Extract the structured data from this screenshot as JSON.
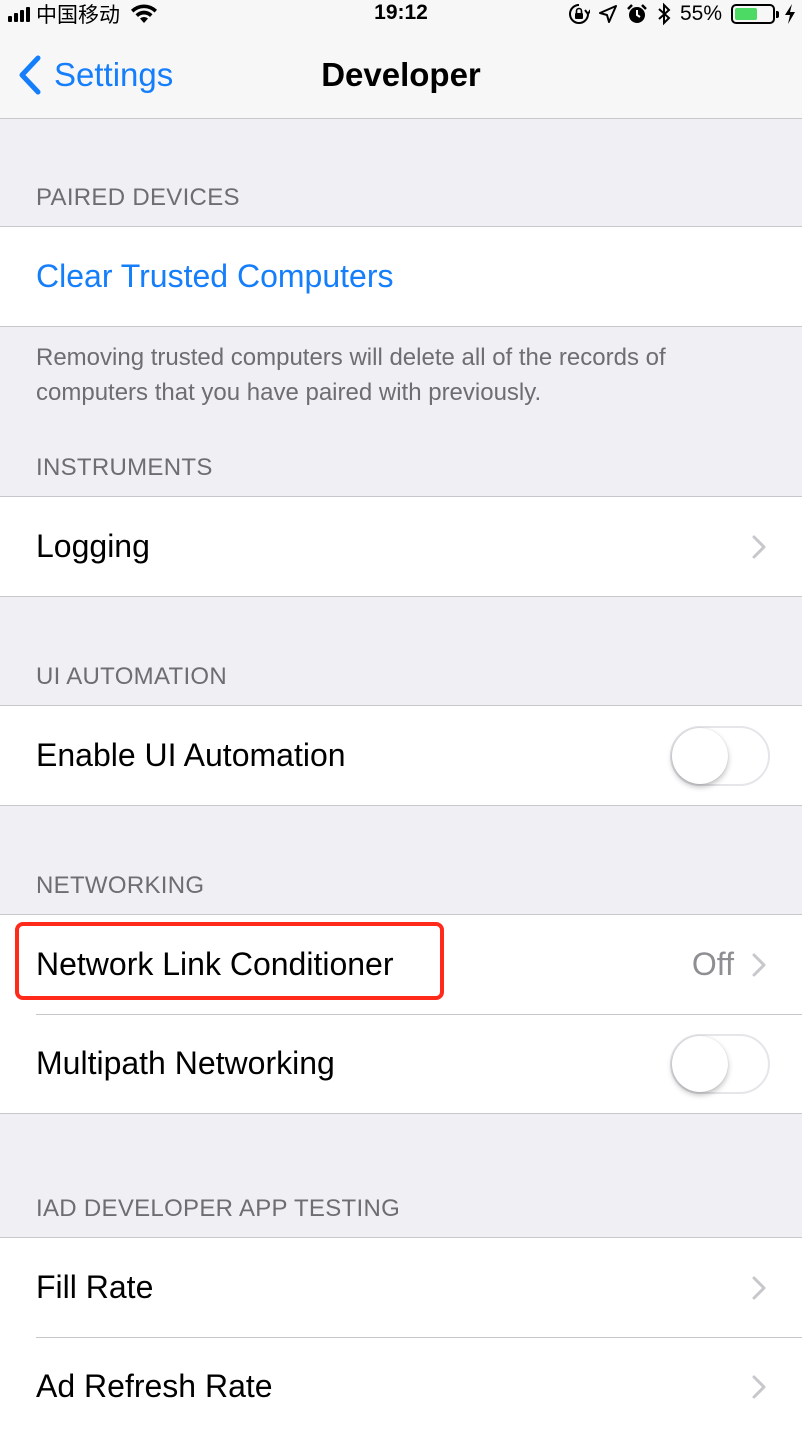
{
  "status_bar": {
    "carrier": "中国移动",
    "time": "19:12",
    "battery_percent": "55%",
    "battery_level": 0.55,
    "icons": [
      "signal-icon",
      "wifi-icon",
      "orientation-lock-icon",
      "location-icon",
      "alarm-icon",
      "bluetooth-icon",
      "battery-icon",
      "charging-icon"
    ]
  },
  "nav": {
    "back_label": "Settings",
    "title": "Developer"
  },
  "sections": {
    "paired_devices": {
      "header": "PAIRED DEVICES",
      "clear_label": "Clear Trusted Computers",
      "footer": "Removing trusted computers will delete all of the records of computers that you have paired with previously."
    },
    "instruments": {
      "header": "INSTRUMENTS",
      "logging_label": "Logging"
    },
    "ui_automation": {
      "header": "UI AUTOMATION",
      "enable_label": "Enable UI Automation",
      "enable_on": false
    },
    "networking": {
      "header": "NETWORKING",
      "nlc_label": "Network Link Conditioner",
      "nlc_value": "Off",
      "multipath_label": "Multipath Networking",
      "multipath_on": false
    },
    "iad": {
      "header": "IAD DEVELOPER APP TESTING",
      "fill_rate_label": "Fill Rate",
      "ad_refresh_label": "Ad Refresh Rate"
    }
  },
  "colors": {
    "accent": "#147efb",
    "background": "#efeff4",
    "highlight": "#ff2a1a",
    "battery": "#4cd964"
  }
}
